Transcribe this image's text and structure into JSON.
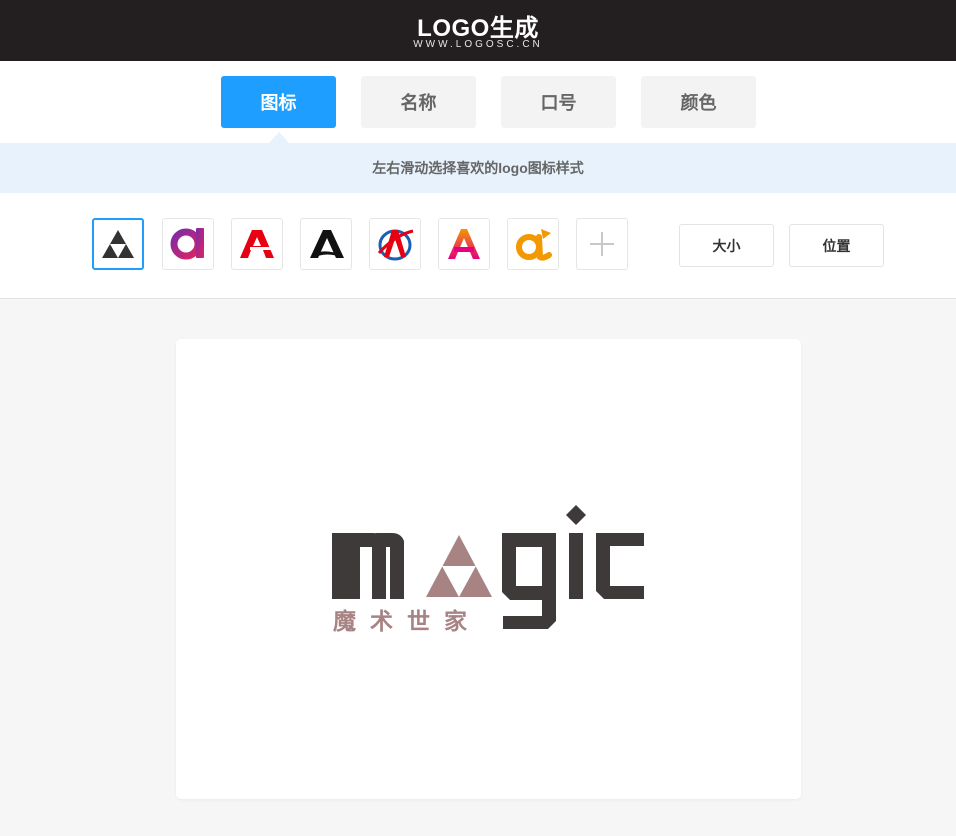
{
  "header": {
    "title": "LOGO生成",
    "url": "WWW.LOGOSC.CN"
  },
  "tabs": [
    {
      "label": "图标",
      "active": true
    },
    {
      "label": "名称",
      "active": false
    },
    {
      "label": "口号",
      "active": false
    },
    {
      "label": "颜色",
      "active": false
    }
  ],
  "hint": "左右滑动选择喜欢的logo图标样式",
  "icons": [
    {
      "name": "triforce-icon",
      "selected": true
    },
    {
      "name": "letter-a-gradient-icon"
    },
    {
      "name": "letter-a-red-icon"
    },
    {
      "name": "letter-a-black-icon"
    },
    {
      "name": "letter-a-orbit-icon"
    },
    {
      "name": "letter-a-pink-icon"
    },
    {
      "name": "letter-a-orange-icon"
    },
    {
      "name": "plus-icon"
    }
  ],
  "options": {
    "size_label": "大小",
    "position_label": "位置"
  },
  "logo": {
    "wordmark": "magic",
    "subtitle": "魔术世家"
  },
  "colors": {
    "accent": "#1e9fff",
    "header_bg": "#231f20",
    "logo_dark": "#3e3a39",
    "logo_rose": "#a88383"
  }
}
